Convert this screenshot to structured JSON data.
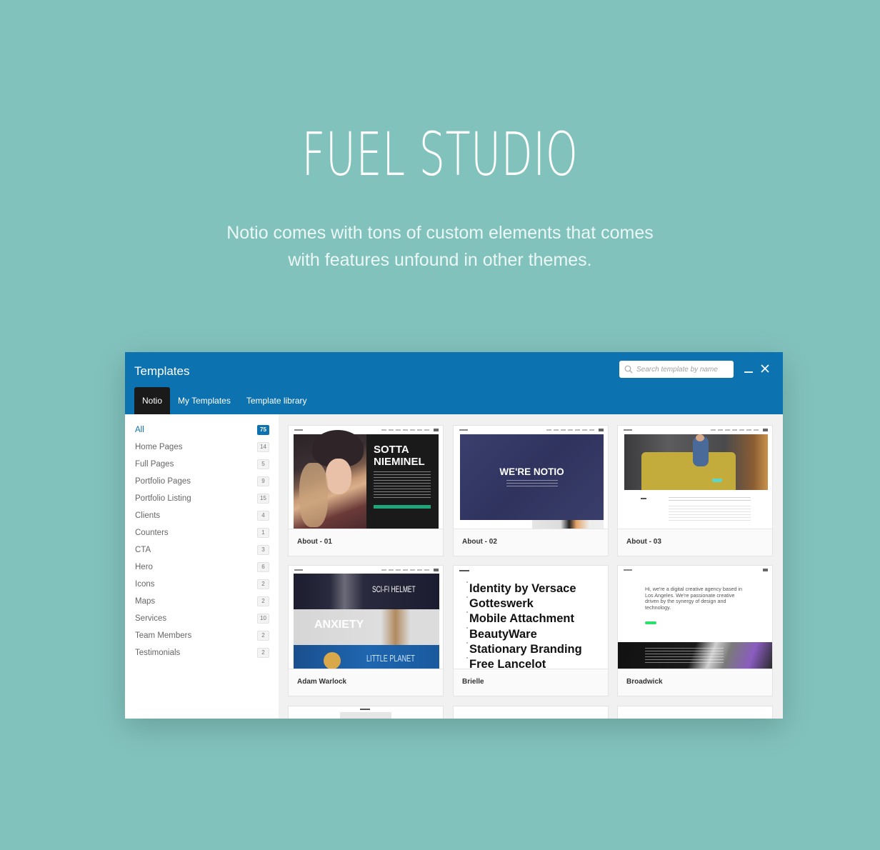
{
  "hero": {
    "title": "FUEL STUDIO",
    "subtitle_line1": "Notio comes with tons of custom elements that comes",
    "subtitle_line2": "with features unfound in other themes."
  },
  "window": {
    "title": "Templates",
    "search_placeholder": "Search template by name",
    "minimize_icon": "minimize-icon",
    "close_icon": "close-icon",
    "accent_color": "#0d72b0",
    "tabs": [
      {
        "label": "Notio",
        "active": true
      },
      {
        "label": "My Templates",
        "active": false
      },
      {
        "label": "Template library",
        "active": false
      }
    ]
  },
  "sidebar": {
    "categories": [
      {
        "label": "All",
        "count": "75",
        "active": true
      },
      {
        "label": "Home Pages",
        "count": "14"
      },
      {
        "label": "Full Pages",
        "count": "5"
      },
      {
        "label": "Portfolio Pages",
        "count": "9"
      },
      {
        "label": "Portfolio Listing",
        "count": "15"
      },
      {
        "label": "Clients",
        "count": "4"
      },
      {
        "label": "Counters",
        "count": "1"
      },
      {
        "label": "CTA",
        "count": "3"
      },
      {
        "label": "Hero",
        "count": "6"
      },
      {
        "label": "Icons",
        "count": "2"
      },
      {
        "label": "Maps",
        "count": "2"
      },
      {
        "label": "Services",
        "count": "10"
      },
      {
        "label": "Team Members",
        "count": "2"
      },
      {
        "label": "Testimonials",
        "count": "2"
      }
    ]
  },
  "templates": [
    {
      "name": "About - 01",
      "preview_heading_1": "SOTTA",
      "preview_heading_2": "NIEMINEL"
    },
    {
      "name": "About - 02",
      "preview_heading": "WE'RE NOTIO"
    },
    {
      "name": "About - 03"
    },
    {
      "name": "Adam Warlock",
      "preview_rows": [
        "SCI-FI HELMET",
        "ANXIETY",
        "LITTLE PLANET"
      ]
    },
    {
      "name": "Brielle",
      "preview_list": [
        "Identity by Versace",
        "Gotteswerk",
        "Mobile Attachment",
        "BeautyWare",
        "Stationary Branding",
        "Free Lancelot"
      ]
    },
    {
      "name": "Broadwick",
      "preview_text": "Hi, we're a digital creative agency based in Los Angeles. We're passionate creative driven by the synergy of design and technology."
    }
  ]
}
